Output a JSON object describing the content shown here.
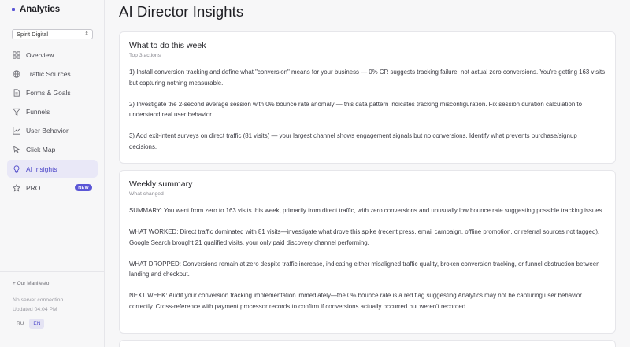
{
  "app": {
    "name": "Analytics"
  },
  "site_selector": {
    "value": "Spirit Digital"
  },
  "nav": [
    {
      "key": "overview",
      "label": "Overview",
      "icon": "grid-icon",
      "active": false
    },
    {
      "key": "traffic-sources",
      "label": "Traffic Sources",
      "icon": "globe-icon",
      "active": false
    },
    {
      "key": "forms-goals",
      "label": "Forms & Goals",
      "icon": "document-icon",
      "active": false
    },
    {
      "key": "funnels",
      "label": "Funnels",
      "icon": "funnel-icon",
      "active": false
    },
    {
      "key": "user-behavior",
      "label": "User Behavior",
      "icon": "line-chart-icon",
      "active": false
    },
    {
      "key": "click-map",
      "label": "Click Map",
      "icon": "cursor-icon",
      "active": false
    },
    {
      "key": "ai-insights",
      "label": "AI Insights",
      "icon": "lightbulb-icon",
      "active": true
    },
    {
      "key": "pro",
      "label": "PRO",
      "icon": "star-icon",
      "active": false,
      "badge": "NEW"
    }
  ],
  "sidebar_footer": {
    "manifesto": "+ Our Manifesto",
    "connection": "No server connection",
    "updated": "Updated 04:04 PM",
    "languages": [
      {
        "label": "RU",
        "active": false
      },
      {
        "label": "EN",
        "active": true
      }
    ]
  },
  "page": {
    "title": "AI Director Insights"
  },
  "todo_card": {
    "title": "What to do this week",
    "subtitle": "Top 3 actions",
    "paragraphs": [
      "1) Install conversion tracking and define what \"conversion\" means for your business — 0% CR suggests tracking failure, not actual zero conversions. You're getting 163 visits but capturing nothing measurable.",
      "2) Investigate the 2-second average session with 0% bounce rate anomaly — this data pattern indicates tracking misconfiguration. Fix session duration calculation to understand real user behavior.",
      "3) Add exit-intent surveys on direct traffic (81 visits) — your largest channel shows engagement signals but no conversions. Identify what prevents purchase/signup decisions."
    ]
  },
  "summary_card": {
    "title": "Weekly summary",
    "subtitle": "What changed",
    "paragraphs": [
      "SUMMARY: You went from zero to 163 visits this week, primarily from direct traffic, with zero conversions and unusually low bounce rate suggesting possible tracking issues.",
      "WHAT WORKED: Direct traffic dominated with 81 visits—investigate what drove this spike (recent press, email campaign, offline promotion, or referral sources not tagged). Google Search brought 21 qualified visits, your only paid discovery channel performing.",
      "WHAT DROPPED: Conversions remain at zero despite traffic increase, indicating either misaligned traffic quality, broken conversion tracking, or funnel obstruction between landing and checkout.",
      "NEXT WEEK: Audit your conversion tracking implementation immediately—the 0% bounce rate is a red flag suggesting Analytics may not be capturing user behavior correctly. Cross-reference with payment processor records to confirm if conversions actually occurred but weren't recorded."
    ]
  },
  "colors": {
    "accent": "#5b56d6",
    "active_bg": "#e9e8f7",
    "background": "#f7f7f8",
    "card": "#ffffff"
  }
}
